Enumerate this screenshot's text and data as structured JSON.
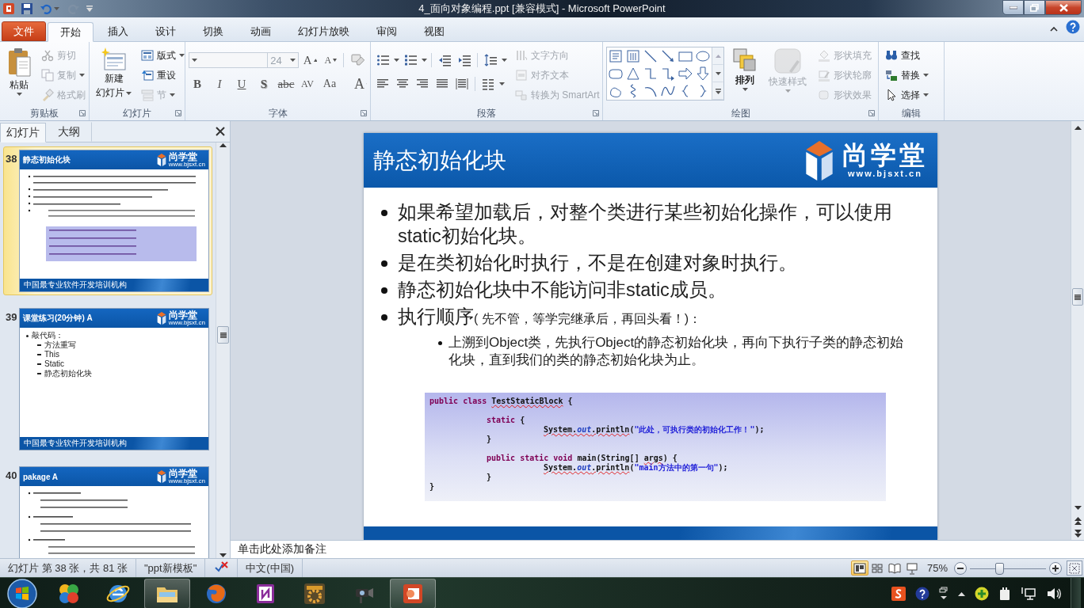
{
  "window": {
    "title": "4_面向对象编程.ppt [兼容模式] - Microsoft PowerPoint"
  },
  "quick_access": [
    {
      "disabled": false
    },
    {
      "disabled": false
    },
    {
      "disabled": true
    }
  ],
  "ribbon_tabs": [
    {
      "label": "文件",
      "kind": "file",
      "selected": false
    },
    {
      "label": "开始",
      "kind": "tab",
      "selected": true
    },
    {
      "label": "插入",
      "kind": "tab",
      "selected": false
    },
    {
      "label": "设计",
      "kind": "tab",
      "selected": false
    },
    {
      "label": "切换",
      "kind": "tab",
      "selected": false
    },
    {
      "label": "动画",
      "kind": "tab",
      "selected": false
    },
    {
      "label": "幻灯片放映",
      "kind": "tab",
      "selected": false
    },
    {
      "label": "审阅",
      "kind": "tab",
      "selected": false
    },
    {
      "label": "视图",
      "kind": "tab",
      "selected": false
    }
  ],
  "clipboard": {
    "label": "剪贴板",
    "paste": "粘贴",
    "items": [
      {
        "label": "剪切",
        "disabled": true,
        "menu": false
      },
      {
        "label": "复制",
        "disabled": true,
        "menu": true
      },
      {
        "label": "格式刷",
        "disabled": true,
        "menu": false
      }
    ]
  },
  "slides_group": {
    "label": "幻灯片",
    "new_slide": [
      "新建",
      "幻灯片"
    ],
    "items": [
      {
        "label": "版式",
        "disabled": false,
        "menu": true
      },
      {
        "label": "重设",
        "disabled": false,
        "menu": false
      },
      {
        "label": "节",
        "disabled": true,
        "menu": true
      }
    ]
  },
  "font": {
    "label": "字体",
    "size": "24",
    "grow": "A",
    "shrink": "A",
    "format_buttons": [
      "B",
      "I",
      "U",
      "S",
      "abc",
      "AV",
      "Aa"
    ],
    "color_button": "A"
  },
  "paragraph": {
    "label": "段落",
    "items": [
      {
        "label": "文字方向",
        "disabled": true
      },
      {
        "label": "对齐文本",
        "disabled": true
      },
      {
        "label": "转换为 SmartArt",
        "disabled": true
      }
    ]
  },
  "drawing": {
    "label": "绘图",
    "arrange": "排列",
    "quick_styles": {
      "label": "快速样式",
      "disabled": true
    },
    "items": [
      {
        "label": "形状填充",
        "disabled": true
      },
      {
        "label": "形状轮廓",
        "disabled": true
      },
      {
        "label": "形状效果",
        "disabled": true
      }
    ]
  },
  "editing": {
    "label": "编辑",
    "items": [
      {
        "label": "查找",
        "menu": false
      },
      {
        "label": "替换",
        "menu": true
      },
      {
        "label": "选择",
        "menu": true
      }
    ]
  },
  "panel_tabs": [
    {
      "label": "幻灯片",
      "selected": true
    },
    {
      "label": "大纲",
      "selected": false
    }
  ],
  "thumbnails": [
    {
      "number": "38",
      "title": "静态初始化块",
      "kind": "code_sketch",
      "selected": true,
      "logo": {
        "name": "尚学堂",
        "url": "www.bjsxt.cn"
      },
      "footer": "中国最专业软件开发培训机构"
    },
    {
      "number": "39",
      "title": "课堂练习(20分钟) A",
      "kind": "bullets",
      "selected": false,
      "logo": {
        "name": "尚学堂",
        "url": "www.bjsxt.cn"
      },
      "footer": "中国最专业软件开发培训机构",
      "bullets": [
        {
          "text": "敲代码：",
          "children": [
            {
              "text": "方法重写"
            },
            {
              "text": "This"
            },
            {
              "text": "Static"
            },
            {
              "text": "静态初始化块"
            }
          ]
        }
      ]
    },
    {
      "number": "40",
      "title": "pakage   A",
      "kind": "text_sketch",
      "selected": false,
      "logo": {
        "name": "尚学堂",
        "url": "www.bjsxt.cn"
      }
    }
  ],
  "slide": {
    "title": "静态初始化块",
    "logo": {
      "name": "尚学堂",
      "url": "www.bjsxt.cn"
    },
    "bullets": [
      {
        "text": "如果希望加载后，对整个类进行某些初始化操作，可以使用static初始化块。"
      },
      {
        "text": "是在类初始化时执行，不是在创建对象时执行。"
      },
      {
        "text": "静态初始化块中不能访问非static成员。"
      },
      {
        "text": "执行顺序",
        "note": "( 先不管，等学完继承后，再回头看！)：",
        "children": [
          {
            "text": "上溯到Object类，先执行Object的静态初始化块，再向下执行子类的静态初始化块，直到我们的类的静态初始化块为止。"
          }
        ]
      }
    ],
    "code": [
      {
        "gap_before": false,
        "parts": [
          {
            "text": "public class ",
            "kind": "kw",
            "misspelled": false
          },
          {
            "text": "TestStaticBlock",
            "kind": "plain",
            "misspelled": true
          },
          {
            "text": " {",
            "kind": "plain",
            "misspelled": false
          }
        ],
        "children": [
          {
            "gap_before": true,
            "parts": [
              {
                "text": "static",
                "kind": "kw",
                "misspelled": false
              },
              {
                "text": " {",
                "kind": "plain",
                "misspelled": false
              }
            ],
            "children": [
              {
                "gap_before": false,
                "parts": [
                  {
                    "text": "System.",
                    "kind": "plain",
                    "misspelled": true
                  },
                  {
                    "text": "out",
                    "kind": "field",
                    "misspelled": true
                  },
                  {
                    "text": ".println",
                    "kind": "plain",
                    "misspelled": true
                  },
                  {
                    "text": "(",
                    "kind": "plain",
                    "misspelled": false
                  },
                  {
                    "text": "\"此处，可执行类的初始化工作！\"",
                    "kind": "str",
                    "misspelled": false
                  },
                  {
                    "text": ");",
                    "kind": "plain",
                    "misspelled": false
                  }
                ]
              }
            ]
          },
          {
            "gap_before": false,
            "parts": [
              {
                "text": "}",
                "kind": "plain",
                "misspelled": false
              }
            ]
          },
          {
            "gap_before": true,
            "parts": [
              {
                "text": "public static void ",
                "kind": "kw",
                "misspelled": false
              },
              {
                "text": "main(String[] ",
                "kind": "plain",
                "misspelled": false
              },
              {
                "text": "args",
                "kind": "plain",
                "misspelled": true
              },
              {
                "text": ") {",
                "kind": "plain",
                "misspelled": false
              }
            ],
            "children": [
              {
                "gap_before": false,
                "parts": [
                  {
                    "text": "System.",
                    "kind": "plain",
                    "misspelled": true
                  },
                  {
                    "text": "out",
                    "kind": "field",
                    "misspelled": true
                  },
                  {
                    "text": ".println",
                    "kind": "plain",
                    "misspelled": true
                  },
                  {
                    "text": "(",
                    "kind": "plain",
                    "misspelled": false
                  },
                  {
                    "text": "\"main方法中的第一句\"",
                    "kind": "str",
                    "misspelled": false
                  },
                  {
                    "text": ");",
                    "kind": "plain",
                    "misspelled": false
                  }
                ]
              }
            ]
          },
          {
            "gap_before": false,
            "parts": [
              {
                "text": "}",
                "kind": "plain",
                "misspelled": false
              }
            ]
          }
        ]
      },
      {
        "gap_before": false,
        "parts": [
          {
            "text": "}",
            "kind": "plain",
            "misspelled": false
          }
        ]
      }
    ]
  },
  "notes": {
    "text": "单击此处添加备注"
  },
  "status": {
    "slide_info": "幻灯片 第 38 张，共 81 张",
    "theme": "\"ppt新模板\"",
    "language": "中文(中国)",
    "views": [
      {
        "selected": true
      },
      {
        "selected": false
      },
      {
        "selected": false
      },
      {
        "selected": false
      }
    ],
    "zoom": "75%",
    "zoom_slider": {
      "level": 0.38
    }
  },
  "taskbar": {
    "apps": [
      {
        "active": false
      },
      {
        "active": false
      },
      {
        "active": true
      },
      {
        "active": false
      },
      {
        "active": false
      },
      {
        "active": false
      },
      {
        "active": false
      },
      {
        "active": true
      }
    ]
  }
}
